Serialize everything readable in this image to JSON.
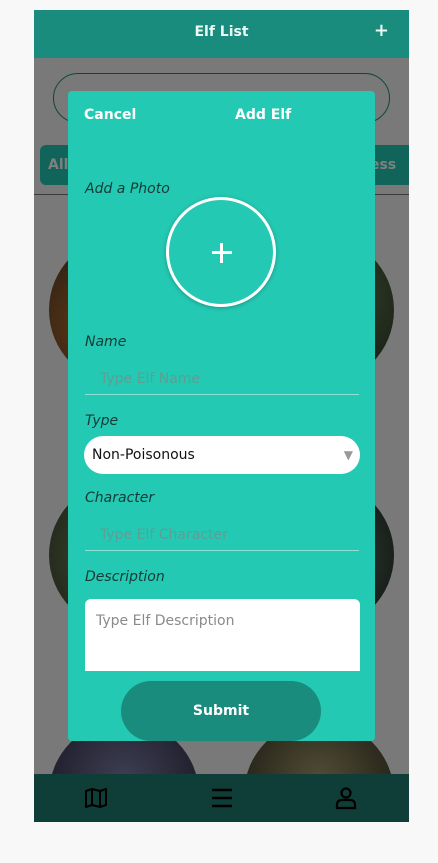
{
  "header": {
    "title": "Elf List",
    "add_label": "+"
  },
  "filters": {
    "first": "All",
    "last": "ness"
  },
  "modal": {
    "cancel_label": "Cancel",
    "title": "Add Elf",
    "photo_label": "Add a Photo",
    "name": {
      "label": "Name",
      "placeholder": "Type Elf Name"
    },
    "type": {
      "label": "Type",
      "selected": "Non-Poisonous"
    },
    "character": {
      "label": "Character",
      "placeholder": "Type Elf Character"
    },
    "description": {
      "label": "Description",
      "placeholder": "Type Elf Description"
    },
    "submit_label": "Submit"
  },
  "bottom_nav": {
    "icons": [
      "map-icon",
      "menu-icon",
      "profile-icon"
    ]
  },
  "colors": {
    "accent": "#23c9b2",
    "dark_accent": "#1a8c7e",
    "bar": "#0f3d37"
  }
}
